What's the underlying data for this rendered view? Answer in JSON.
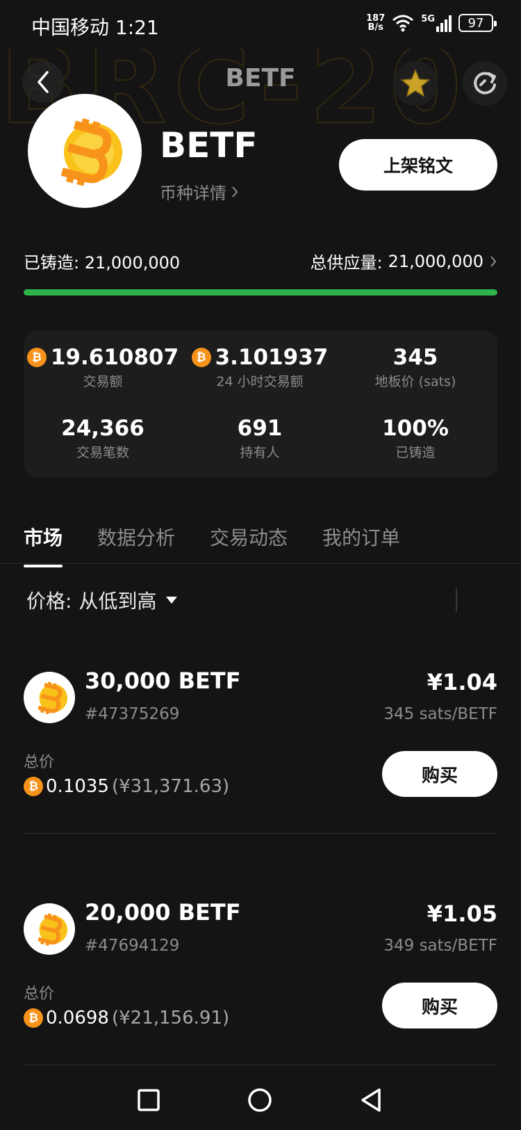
{
  "status_bar": {
    "carrier_time": "中国移动 1:21",
    "net_speed_value": "187",
    "net_speed_unit": "B/s",
    "network": "5G",
    "battery": "97"
  },
  "nav": {
    "title": "BETF",
    "back_icon": "chevron-left-icon",
    "favorite_icon": "star-icon",
    "refresh_icon": "refresh-icon"
  },
  "token": {
    "name": "BETF",
    "detail_link": "币种详情",
    "list_button": "上架铭文",
    "accent": "#f7931a"
  },
  "mint": {
    "minted_label": "已铸造:",
    "minted_value": "21,000,000",
    "supply_label": "总供应量:",
    "supply_value": "21,000,000",
    "progress_fraction": 1.0,
    "progress_color": "#2db34a"
  },
  "stats": [
    {
      "value": "19.610807",
      "label": "交易额",
      "btc": true
    },
    {
      "value": "3.101937",
      "label": "24 小时交易额",
      "btc": true
    },
    {
      "value": "345",
      "label": "地板价 (sats)",
      "btc": false
    },
    {
      "value": "24,366",
      "label": "交易笔数",
      "btc": false
    },
    {
      "value": "691",
      "label": "持有人",
      "btc": false
    },
    {
      "value": "100%",
      "label": "已铸造",
      "btc": false
    }
  ],
  "tabs": [
    {
      "label": "市场",
      "active": true
    },
    {
      "label": "数据分析",
      "active": false
    },
    {
      "label": "交易动态",
      "active": false
    },
    {
      "label": "我的订单",
      "active": false
    }
  ],
  "sort": {
    "label": "价格:",
    "value": "从低到高"
  },
  "listings": [
    {
      "amount": "30,000 BETF",
      "id": "#47375269",
      "price": "¥1.04",
      "unit_price": "345 sats/BETF",
      "total_label": "总价",
      "total_btc": "0.1035",
      "total_cny": "(¥31,371.63)",
      "buy_label": "购买"
    },
    {
      "amount": "20,000 BETF",
      "id": "#47694129",
      "price": "¥1.05",
      "unit_price": "349 sats/BETF",
      "total_label": "总价",
      "total_btc": "0.0698",
      "total_cny": "(¥21,156.91)",
      "buy_label": "购买"
    }
  ]
}
